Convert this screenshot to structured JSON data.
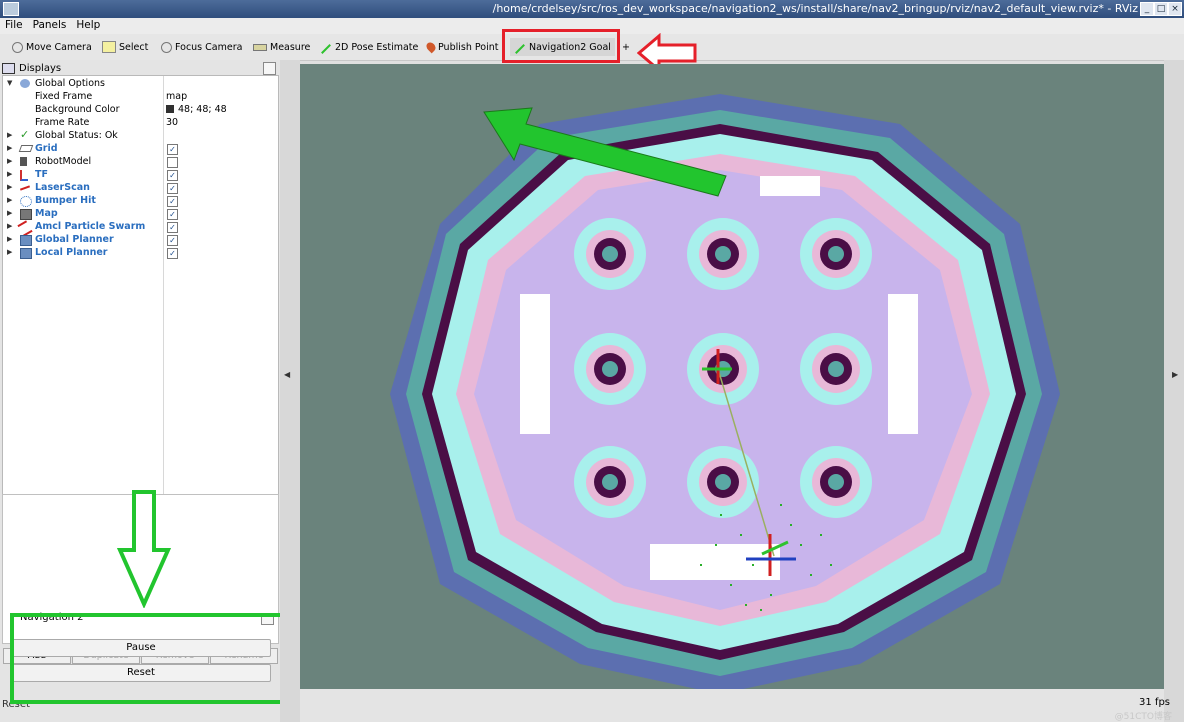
{
  "window": {
    "title": "/home/crdelsey/src/ros_dev_workspace/navigation2_ws/install/share/nav2_bringup/rviz/nav2_default_view.rviz* - RViz"
  },
  "menu": [
    "File",
    "Panels",
    "Help"
  ],
  "toolbar": {
    "move_camera": "Move Camera",
    "select": "Select",
    "focus_camera": "Focus Camera",
    "measure": "Measure",
    "pose_estimate": "2D Pose Estimate",
    "publish_point": "Publish Point",
    "nav_goal": "Navigation2 Goal"
  },
  "displays": {
    "title": "Displays",
    "global_options": "Global Options",
    "fixed_frame_label": "Fixed Frame",
    "fixed_frame_value": "map",
    "background_label": "Background Color",
    "background_value": "48; 48; 48",
    "frame_rate_label": "Frame Rate",
    "frame_rate_value": "30",
    "global_status": "Global Status: Ok",
    "items": [
      {
        "label": "Grid",
        "checked": true
      },
      {
        "label": "RobotModel",
        "checked": false
      },
      {
        "label": "TF",
        "checked": true
      },
      {
        "label": "LaserScan",
        "checked": true
      },
      {
        "label": "Bumper Hit",
        "checked": true
      },
      {
        "label": "Map",
        "checked": true
      },
      {
        "label": "Amcl Particle Swarm",
        "checked": true
      },
      {
        "label": "Global Planner",
        "checked": true
      },
      {
        "label": "Local Planner",
        "checked": true
      }
    ],
    "check_mark": "✓"
  },
  "panel_buttons": {
    "add": "Add",
    "duplicate": "Duplicate",
    "remove": "Remove",
    "rename": "Rename"
  },
  "nav2_panel": {
    "title": "Navigation 2",
    "pause": "Pause",
    "reset": "Reset"
  },
  "status": {
    "reset": "Reset",
    "fps": "31 fps"
  },
  "watermark": "@51CTO博客",
  "colors": {
    "annotation_red": "#e5202a",
    "annotation_green": "#22c52e",
    "link_blue": "#2a6ebf"
  }
}
